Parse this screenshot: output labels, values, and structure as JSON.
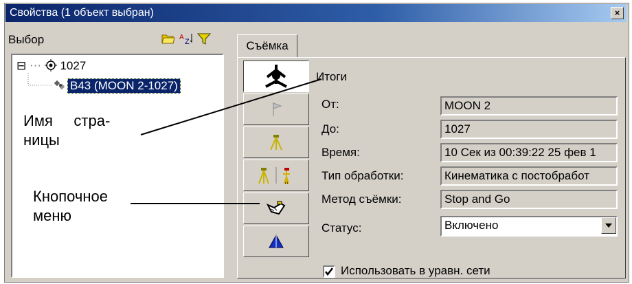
{
  "window": {
    "title": "Свойства (1 объект выбран)",
    "close_label": "×"
  },
  "left_pane": {
    "header_label": "Выбор",
    "toolbar_icons": [
      "open-folder-icon",
      "sort-az-icon",
      "filter-icon"
    ],
    "tree": [
      {
        "expander": "⊟",
        "label": "1027",
        "icon": "point-target-icon"
      },
      {
        "label": "B43 (MOON 2-1027)",
        "icon": "satellite-icon",
        "selected": true
      }
    ]
  },
  "right_pane": {
    "tab_label": "Съёмка",
    "buttons": [
      "surveyor-total-station-icon",
      "flag-icon",
      "tripod-icon",
      "tripod-rover-icon",
      "edit-hand-icon",
      "triangle-icon"
    ],
    "summary_label": "Итоги",
    "fields": [
      {
        "label": "От:",
        "value": "MOON 2"
      },
      {
        "label": "До:",
        "value": "1027"
      },
      {
        "label": "Время:",
        "value": "10 Сек из 00:39:22 25 фев 1"
      },
      {
        "label": "Тип обработки:",
        "value": "Кинематика с постобработ"
      },
      {
        "label": "Метод съёмки:",
        "value": "Stop and Go"
      },
      {
        "label": "Статус:",
        "value": "Включено"
      }
    ],
    "checkbox": {
      "label": "Использовать в уравн. сети",
      "checked": true
    }
  },
  "annotations": {
    "page_name_line1": "Имя     стра-",
    "page_name_line2": "ницы",
    "button_menu_line1": "Кнопочное",
    "button_menu_line2": "меню"
  }
}
